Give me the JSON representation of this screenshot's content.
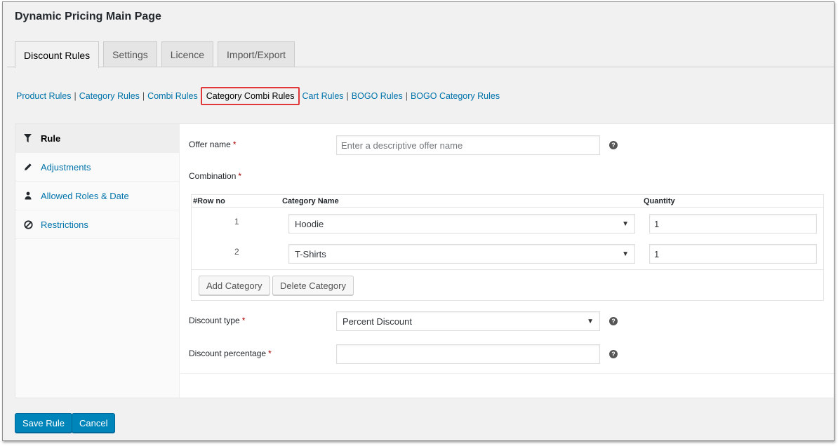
{
  "page": {
    "title": "Dynamic Pricing Main Page"
  },
  "tabs": [
    {
      "label": "Discount Rules",
      "active": true
    },
    {
      "label": "Settings"
    },
    {
      "label": "Licence"
    },
    {
      "label": "Import/Export"
    }
  ],
  "subnav": {
    "product_rules": "Product Rules",
    "category_rules": "Category Rules",
    "combi_rules": "Combi Rules",
    "category_combi_rules": "Category Combi Rules",
    "cart_rules": "Cart Rules",
    "bogo_rules": "BOGO Rules",
    "bogo_category_rules": "BOGO Category Rules",
    "separator": "|"
  },
  "sidebar": {
    "items": [
      {
        "label": "Rule",
        "icon": "filter-icon",
        "active": true
      },
      {
        "label": "Adjustments",
        "icon": "pencil-icon"
      },
      {
        "label": "Allowed Roles & Date",
        "icon": "users-icon"
      },
      {
        "label": "Restrictions",
        "icon": "ban-icon"
      }
    ]
  },
  "form": {
    "required_mark": "*",
    "help_glyph": "?",
    "offer_name": {
      "label": "Offer name",
      "placeholder": "Enter a descriptive offer name",
      "value": ""
    },
    "combination": {
      "label": "Combination",
      "columns": {
        "row_no": "#Row no",
        "category_name": "Category Name",
        "quantity": "Quantity"
      },
      "rows": [
        {
          "row_no": "1",
          "category": "Hoodie",
          "quantity": "1"
        },
        {
          "row_no": "2",
          "category": "T-Shirts",
          "quantity": "1"
        }
      ],
      "add_button": "Add Category",
      "delete_button": "Delete Category"
    },
    "discount_type": {
      "label": "Discount type",
      "value": "Percent Discount"
    },
    "discount_percentage": {
      "label": "Discount percentage",
      "value": ""
    }
  },
  "actions": {
    "save": "Save Rule",
    "cancel": "Cancel"
  },
  "colors": {
    "link": "#0073aa",
    "primary": "#0085ba",
    "highlight": "#e0383a",
    "required": "#a00000"
  }
}
